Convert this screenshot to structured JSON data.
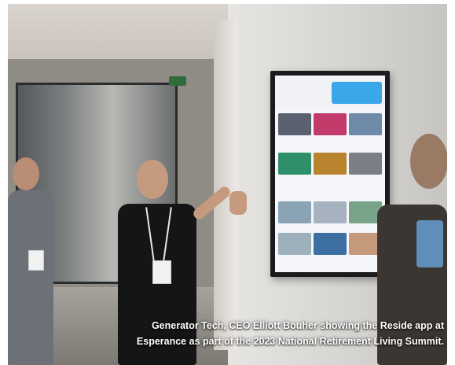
{
  "photo": {
    "alt": "Man presenting a wall-mounted touchscreen display to an audience",
    "colors": {
      "screen_accent": "#3aa7e8",
      "shirt": "#151515",
      "wall": "#e2e0dd"
    }
  },
  "caption": {
    "line1": "Generator Tech, CEO Elliott Bouher showing the Reside app at",
    "line2": "Esperance as part of the 2023 National Retirement Living Summit."
  }
}
